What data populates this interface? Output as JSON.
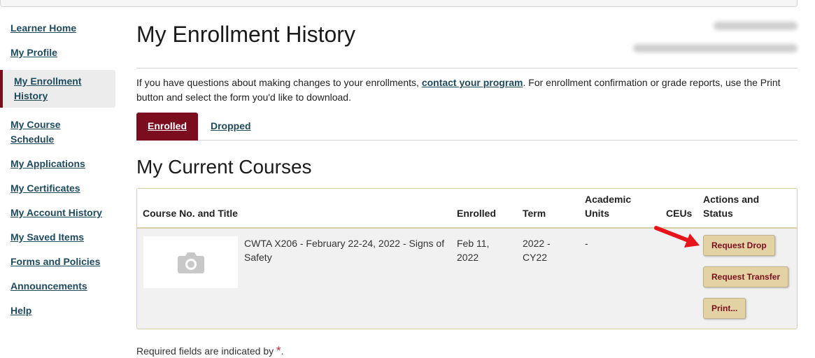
{
  "sidebar": {
    "items": [
      {
        "label": "Learner Home"
      },
      {
        "label": "My Profile"
      },
      {
        "label": "My Enrollment History",
        "active": true
      },
      {
        "label": "My Course Schedule"
      },
      {
        "label": "My Applications"
      },
      {
        "label": "My Certificates"
      },
      {
        "label": "My Account History"
      },
      {
        "label": "My Saved Items"
      },
      {
        "label": "Forms and Policies"
      },
      {
        "label": "Announcements"
      },
      {
        "label": "Help"
      }
    ]
  },
  "header": {
    "title": "My Enrollment History"
  },
  "intro": {
    "before": "If you have questions about making changes to your enrollments, ",
    "link": "contact your program",
    "after": ". For enrollment confirmation or grade reports, use the Print button and select the form you'd like to download."
  },
  "tabs": [
    {
      "label": "Enrolled",
      "active": true
    },
    {
      "label": "Dropped",
      "active": false
    }
  ],
  "section": {
    "title": "My Current Courses"
  },
  "table": {
    "headers": {
      "course": "Course No. and Title",
      "enrolled": "Enrolled",
      "term": "Term",
      "units": "Academic Units",
      "ceus": "CEUs",
      "actions": "Actions and Status"
    },
    "rows": [
      {
        "course": "CWTA X206 - February 22-24, 2022 - Signs of Safety",
        "enrolled": "Feb 11, 2022",
        "term": "2022 - CY22",
        "units": "-",
        "ceus": ""
      }
    ],
    "actions": {
      "drop": "Request Drop",
      "transfer": "Request Transfer",
      "print": "Print..."
    }
  },
  "footer": {
    "required_note": "Required fields are indicated by",
    "star": "*",
    "period": "."
  },
  "icons": {
    "thumbnail": "camera-icon",
    "pointer": "arrow-icon"
  },
  "colors": {
    "brand": "#7b0d1e",
    "link": "#1f4a5c",
    "button_bg": "#e3d2a3",
    "arrow": "#e8141b"
  }
}
